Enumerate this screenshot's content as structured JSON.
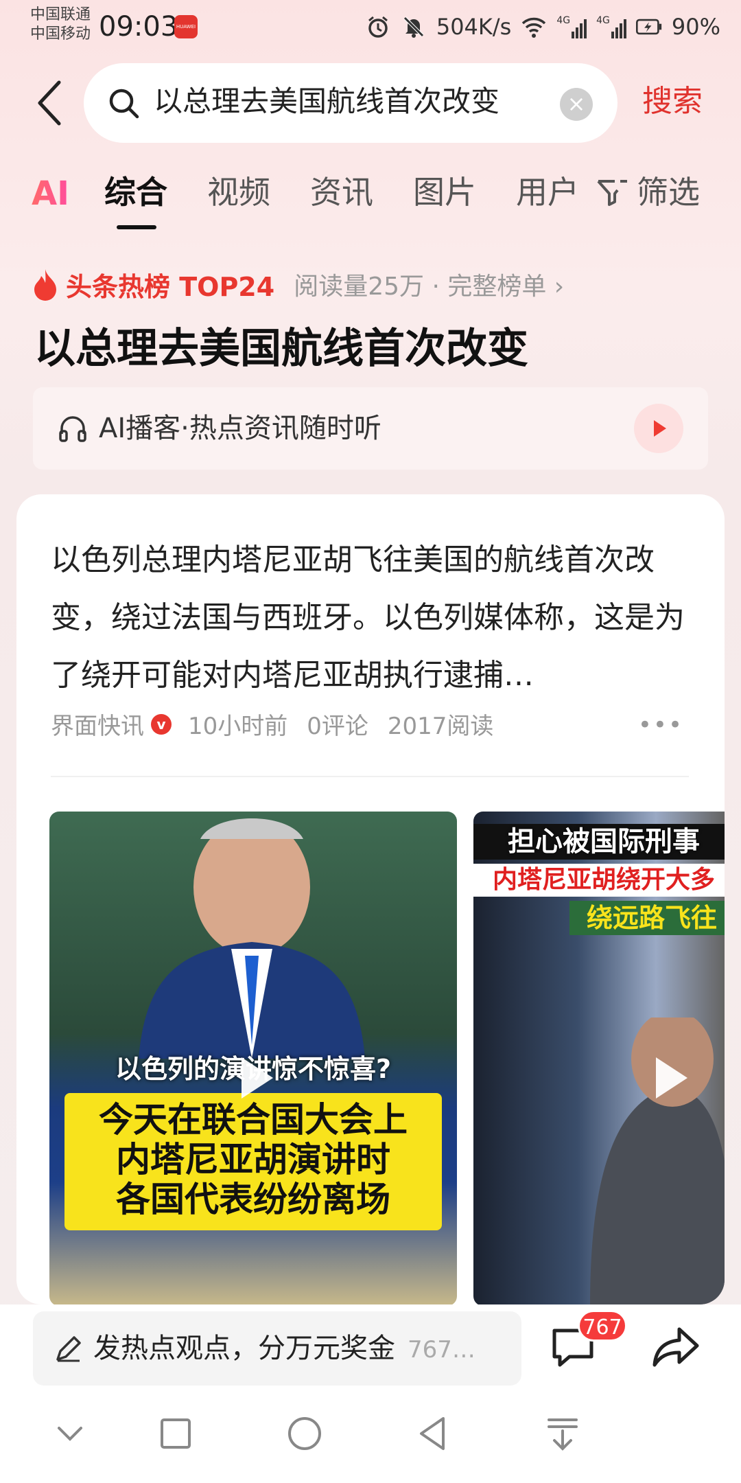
{
  "status_bar": {
    "carrier_1": "中国联通",
    "carrier_2": "中国移动",
    "time": "09:03",
    "brand_badge": "HUAWEI",
    "speed": "504K/s",
    "network_1": "4G",
    "network_2": "4G",
    "battery": "90%"
  },
  "search": {
    "query": "以总理去美国航线首次改变",
    "button_label": "搜索",
    "icons": [
      "back-arrow-icon",
      "search-icon",
      "clear-icon"
    ]
  },
  "tabs": {
    "ai_label": "AI",
    "items": [
      "综合",
      "视频",
      "资讯",
      "图片",
      "用户"
    ],
    "active": "综合",
    "filter_label": "筛选"
  },
  "hot_list": {
    "label": "头条热榜 TOP24",
    "meta": "阅读量25万 · 完整榜单 ›"
  },
  "headline": "以总理去美国航线首次改变",
  "podcast": {
    "label": "AI播客·热点资讯随时听"
  },
  "article": {
    "body": "以色列总理内塔尼亚胡飞往美国的航线首次改变，绕过法国与西班牙。以色列媒体称，这是为了绕开可能对内塔尼亚胡执行逮捕…",
    "source": "界面快讯",
    "verified_badge": "v",
    "time": "10小时前",
    "comments": "0评论",
    "reads": "2017阅读",
    "more": "•••"
  },
  "videos": [
    {
      "caption_top": "以色列的演讲惊不惊喜?",
      "caption_lines": [
        "今天在联合国大会上",
        "内塔尼亚胡演讲时",
        "各国代表纷纷离场"
      ]
    },
    {
      "caption_lines": [
        "担心被国际刑事",
        "内塔尼亚胡绕开大多",
        "绕远路飞往"
      ]
    }
  ],
  "bottom_bar": {
    "comment_placeholder": "发热点观点，分万元奖金",
    "comment_count_hint": "767…",
    "comment_badge": "767"
  },
  "system_nav": [
    "chevron-down-icon",
    "square-icon",
    "circle-icon",
    "back-triangle-icon",
    "download-icon"
  ]
}
